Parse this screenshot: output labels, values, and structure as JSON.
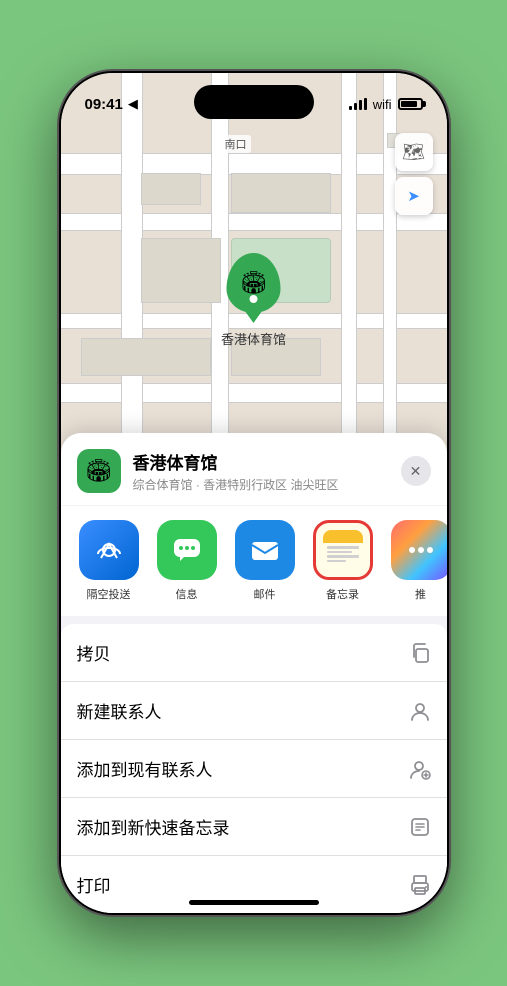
{
  "status": {
    "time": "09:41",
    "nav_arrow": "▲"
  },
  "map": {
    "label": "南口",
    "marker_label": "香港体育馆"
  },
  "controls": {
    "map_btn": "🗺",
    "location_btn": "➤"
  },
  "sheet": {
    "venue_icon": "🏟",
    "venue_name": "香港体育馆",
    "venue_desc": "综合体育馆 · 香港特别行政区 油尖旺区",
    "close_label": "✕"
  },
  "share_items": [
    {
      "id": "airdrop",
      "label": "隔空投送",
      "icon_class": "share-icon-airdrop",
      "icon_text": "📶"
    },
    {
      "id": "message",
      "label": "信息",
      "icon_class": "share-icon-msg",
      "icon_text": "💬"
    },
    {
      "id": "mail",
      "label": "邮件",
      "icon_class": "share-icon-mail",
      "icon_text": "✉️"
    },
    {
      "id": "notes",
      "label": "备忘录",
      "icon_class": "share-icon-notes share-icon-notes-selected",
      "icon_text": "notes"
    },
    {
      "id": "more",
      "label": "推",
      "icon_class": "share-icon-more",
      "icon_text": "···"
    }
  ],
  "actions": [
    {
      "id": "copy",
      "label": "拷贝",
      "icon": "⧉"
    },
    {
      "id": "new-contact",
      "label": "新建联系人",
      "icon": "👤"
    },
    {
      "id": "add-existing",
      "label": "添加到现有联系人",
      "icon": "👤"
    },
    {
      "id": "add-notes",
      "label": "添加到新快速备忘录",
      "icon": "🔲"
    },
    {
      "id": "print",
      "label": "打印",
      "icon": "🖨"
    }
  ]
}
